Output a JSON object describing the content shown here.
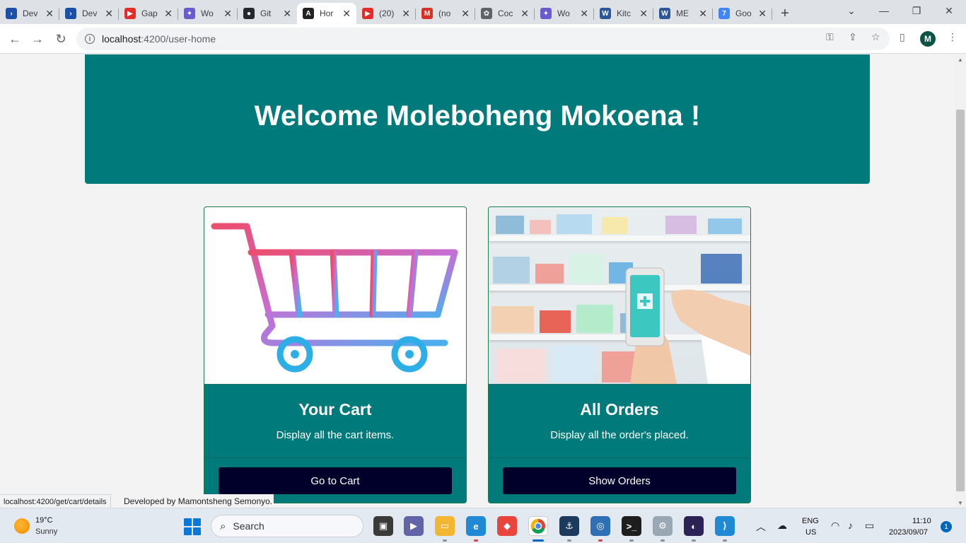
{
  "browser": {
    "tabs": [
      {
        "label": "Dev",
        "icon": "vscode-blue-icon",
        "color": "#1b4fa8"
      },
      {
        "label": "Dev",
        "icon": "vscode-blue-icon",
        "color": "#1b4fa8"
      },
      {
        "label": "Gap",
        "icon": "youtube-icon",
        "color": "#e52d27"
      },
      {
        "label": "Wo",
        "icon": "copilot-icon",
        "color": "#6a5acd"
      },
      {
        "label": "Git",
        "icon": "github-icon",
        "color": "#24292e"
      },
      {
        "label": "Hor",
        "icon": "angular-icon",
        "color": "#222222"
      },
      {
        "label": "(20)",
        "icon": "youtube-icon",
        "color": "#e52d27"
      },
      {
        "label": "(no",
        "icon": "gmail-icon",
        "color": "#d93025"
      },
      {
        "label": "Coc",
        "icon": "chatgpt-icon",
        "color": "#5f6368"
      },
      {
        "label": "Wo",
        "icon": "copilot-icon",
        "color": "#6a5acd"
      },
      {
        "label": "Kitc",
        "icon": "word-icon",
        "color": "#2b579a"
      },
      {
        "label": "ME",
        "icon": "word-icon",
        "color": "#2b579a"
      },
      {
        "label": "Goo",
        "icon": "google-calendar-icon",
        "color": "#4285f4"
      }
    ],
    "active_tab_index": 5,
    "url_host": "localhost",
    "url_path": ":4200/user-home",
    "profile_initial": "M"
  },
  "page": {
    "hero_title": "Welcome Moleboheng Mokoena !",
    "cards": [
      {
        "title": "Your Cart",
        "description": "Display all the cart items.",
        "button": "Go to Cart"
      },
      {
        "title": "All Orders",
        "description": "Display all the order's placed.",
        "button": "Show Orders"
      }
    ],
    "status_url": "localhost:4200/get/cart/details",
    "footer": "Developed by Mamontsheng Semonyo."
  },
  "colors": {
    "teal": "#007a7a",
    "button": "#00002a"
  },
  "taskbar": {
    "weather_temp": "19°C",
    "weather_cond": "Sunny",
    "search_placeholder": "Search",
    "lang_top": "ENG",
    "lang_bottom": "US",
    "time": "11:10",
    "date": "2023/09/07",
    "notification_count": "1"
  }
}
